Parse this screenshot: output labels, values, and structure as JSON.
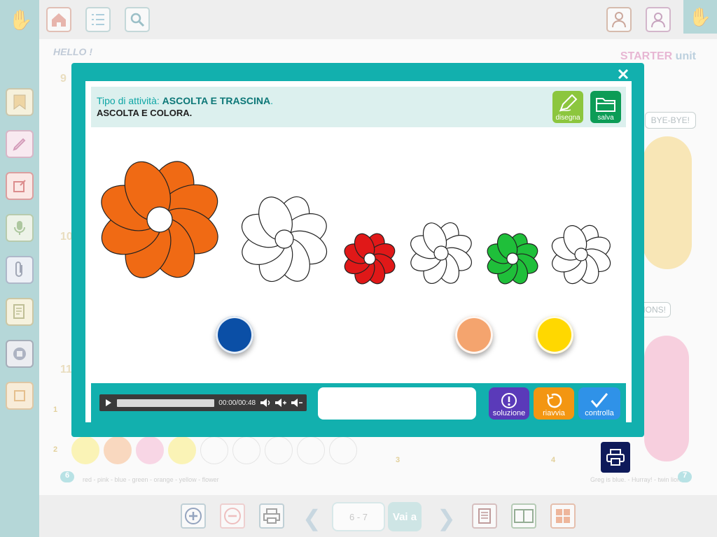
{
  "background": {
    "hello_label": "HELLO !",
    "starter_label": "STARTER",
    "starter_unit": "unit",
    "bubble_bye": "BYE-BYE!",
    "bubble_lions": "LIONS!",
    "section_numbers": [
      "9",
      "10",
      "11"
    ],
    "row_numbers": [
      "1",
      "2",
      "3",
      "4"
    ],
    "badge_left": "6",
    "badge_right": "7",
    "words_left": "red - pink - blue - green - orange - yellow - flower",
    "words_right": "Greg is blue. - Hurray! - twin lions",
    "page_indicator": "6 - 7",
    "vai_a_label": "Vai a",
    "colors": {
      "rail": "#78b7b8",
      "teal": "#12b0ae"
    }
  },
  "modal": {
    "instruction_prefix": "Tipo di attività:",
    "instruction_type": "ASCOLTA E TRASCINA",
    "instruction_end": ".",
    "instruction_task": "ASCOLTA E COLORA.",
    "draw_label": "disegna",
    "save_label": "salva",
    "audio_time": "00:00/00:48",
    "solution_label": "soluzione",
    "restart_label": "riavvia",
    "check_label": "controlla"
  },
  "flowers": [
    {
      "color": "#f06a14",
      "petals": 8
    },
    {
      "color": "#ffffff",
      "petals": 8
    },
    {
      "color": "#e01818",
      "petals": 8
    },
    {
      "color": "#ffffff",
      "petals": 8
    },
    {
      "color": "#1fbf3a",
      "petals": 8
    },
    {
      "color": "#ffffff",
      "petals": 8
    }
  ],
  "paints": [
    {
      "color": "#0b4fa6"
    },
    {
      "color": "#f4a46e"
    },
    {
      "color": "#ffd800"
    }
  ],
  "icons": [
    "hand-icon",
    "home-icon",
    "list-icon",
    "search-icon",
    "teacher-icon",
    "student-icon",
    "close-icon",
    "pencil-icon",
    "folder-icon",
    "play-icon",
    "volume-icon",
    "volume-up-icon",
    "volume-down-icon",
    "solution-icon",
    "restart-icon",
    "check-icon",
    "print-icon",
    "zoom-in-icon",
    "zoom-out-icon",
    "chevron-left-icon",
    "chevron-right-icon",
    "page-icon",
    "book-icon",
    "grid-icon"
  ]
}
